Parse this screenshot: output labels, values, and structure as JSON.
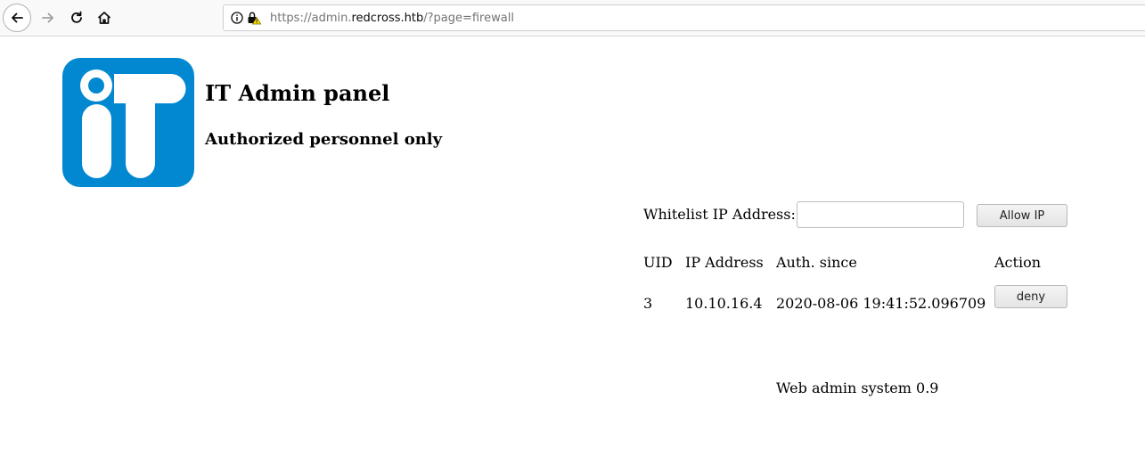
{
  "browser": {
    "url_prefix": "https://admin.",
    "url_host": "redcross.htb",
    "url_suffix": "/?page=firewall"
  },
  "header": {
    "title": "IT Admin panel",
    "subtitle": "Authorized personnel only",
    "logo_icon": "it-logo",
    "logo_color": "#0288d1"
  },
  "whitelist": {
    "label": "Whitelist IP Address:",
    "input_value": "",
    "button_label": "Allow IP"
  },
  "table": {
    "columns": [
      "UID",
      "IP Address",
      "Auth. since",
      "Action"
    ],
    "rows": [
      {
        "uid": "3",
        "ip": "10.10.16.4",
        "since": "2020-08-06 19:41:52.096709",
        "action": "deny"
      }
    ]
  },
  "footer": {
    "text": "Web admin system 0.9"
  }
}
